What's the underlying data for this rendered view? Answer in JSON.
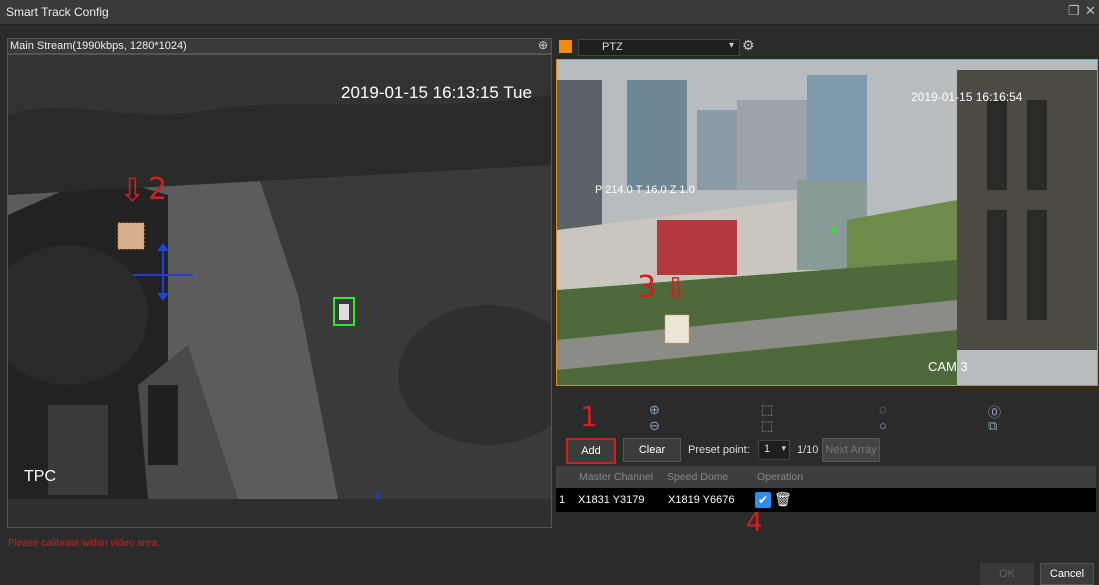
{
  "window": {
    "title": "Smart Track Config",
    "restore_icon": "restore-icon",
    "close_icon": "close-icon"
  },
  "left": {
    "stream_label": "Main Stream(1990kbps, 1280*1024)",
    "timestamp": "2019-01-15 16:13:15 Tue",
    "camera_label": "TPC",
    "warning": "Please calibrate within video area."
  },
  "right": {
    "device_select": "PTZ",
    "timestamp": "2019-01-15 16:16:54",
    "overlay_text": "P 214.0 T 16.0 Z 1.0",
    "camera_label": "CAM 3"
  },
  "controls": {
    "add_label": "Add",
    "clear_label": "Clear",
    "preset_label": "Preset point:",
    "preset_value": "1",
    "array_count": "1/10",
    "next_array_label": "Next Array"
  },
  "table": {
    "headers": [
      "Master Channel",
      "Speed Dome",
      "Operation"
    ],
    "rows": [
      {
        "index": "1",
        "master": "X1831 Y3179",
        "dome": "X1819 Y6676"
      }
    ]
  },
  "footer": {
    "ok_label": "OK",
    "cancel_label": "Cancel"
  },
  "annotations": {
    "n1": "1",
    "n2": "2",
    "n3": "3",
    "n4": "4"
  },
  "colors": {
    "accent": "#f28a10",
    "annotation": "#d21e1e",
    "tracking_box": "#2ee82e"
  }
}
